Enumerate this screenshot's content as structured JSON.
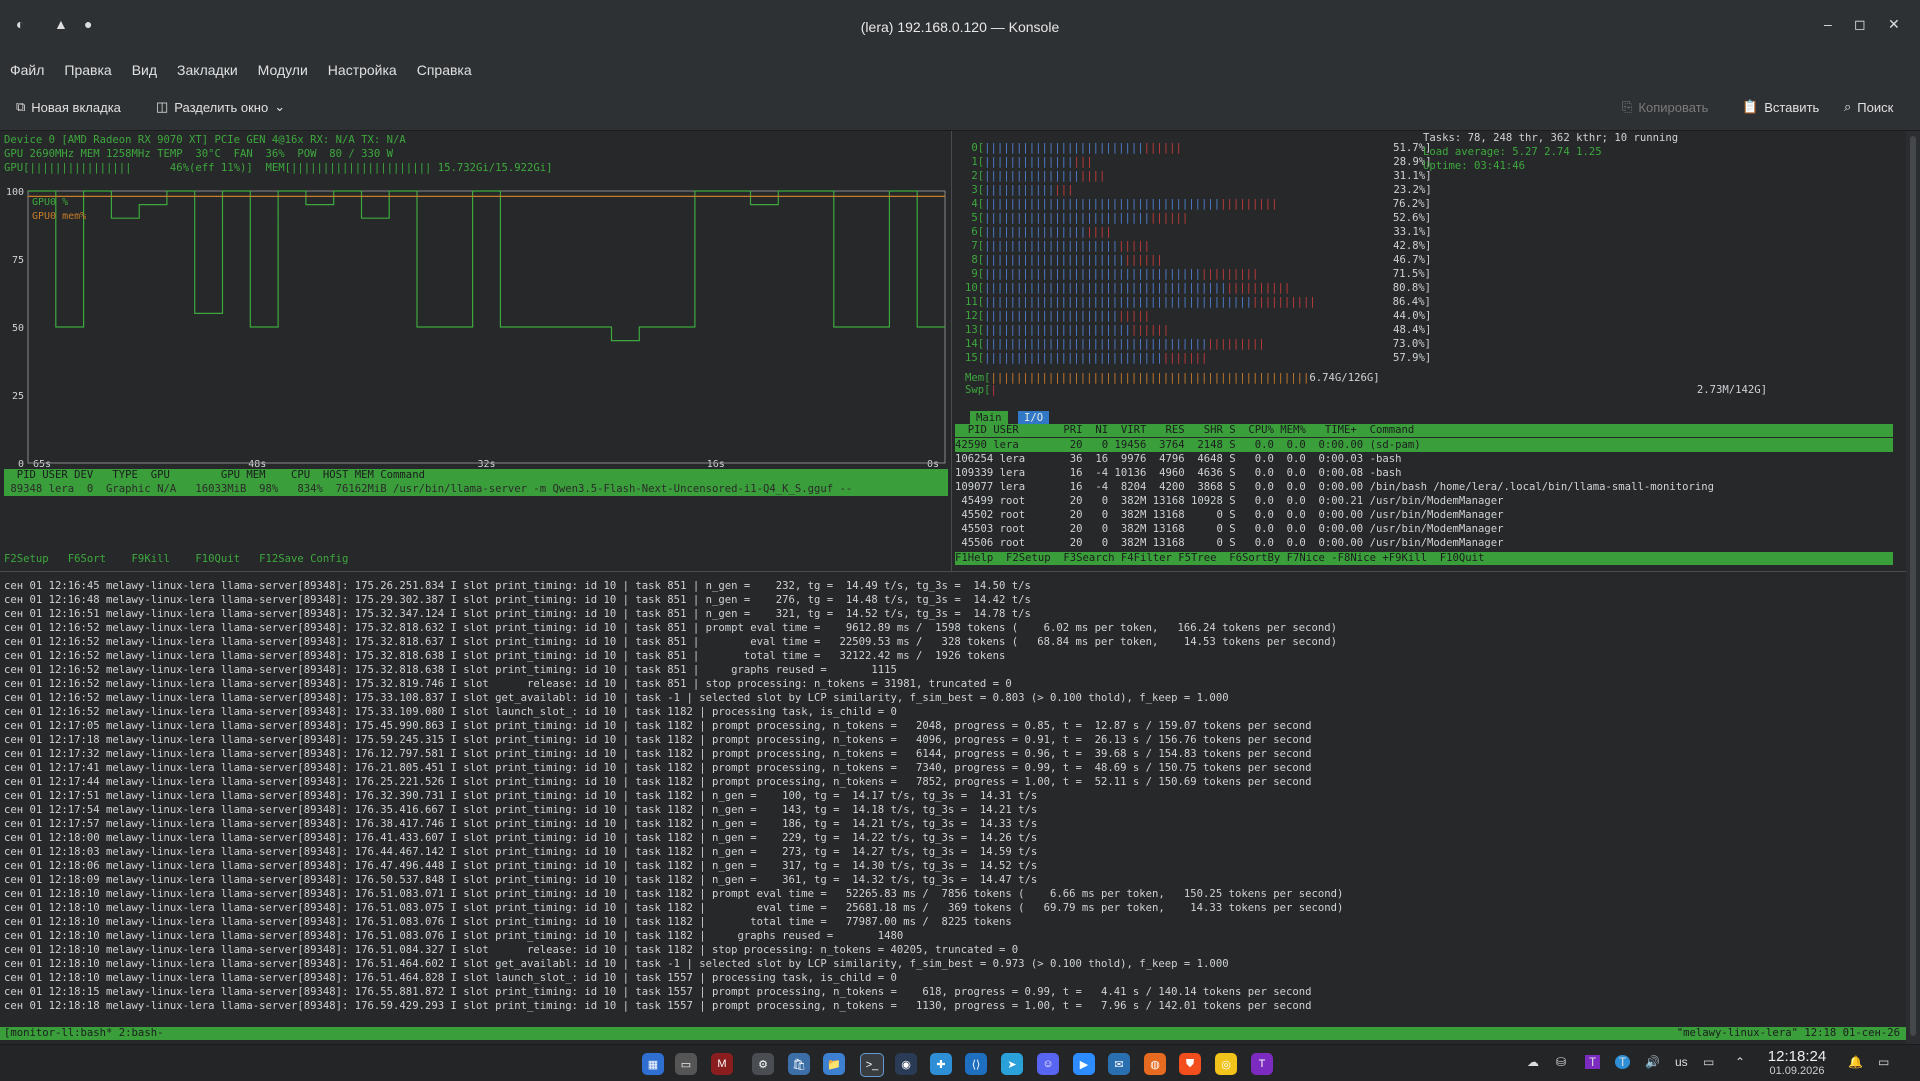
{
  "window": {
    "title": "(lera) 192.168.0.120 — Konsole"
  },
  "menu": [
    "Файл",
    "Правка",
    "Вид",
    "Закладки",
    "Модули",
    "Настройка",
    "Справка"
  ],
  "toolbar": {
    "new_tab": "Новая вкладка",
    "split": "Разделить окно",
    "copy": "Копировать",
    "paste": "Вставить",
    "search": "Поиск"
  },
  "nvtop": {
    "device": "Device 0 [AMD Radeon RX 9070 XT] PCIe GEN 4@16x RX: N/A TX: N/A",
    "gpu_line": "GPU 2690MHz MEM 1258MHz TEMP  30°C  FAN  36%  POW  80 / 330 W",
    "gpu_bar": "GPU[||||||||||||||||      46%(eff 11%)]  MEM[|||||||||||||||||||||| 15.732Gi/15.922Gi]",
    "y_ticks": [
      "100",
      "75",
      "50",
      "25",
      "0"
    ],
    "x_ticks": [
      "65s",
      "48s",
      "32s",
      "16s",
      "0s"
    ],
    "legend": [
      "GPU0 %",
      "GPU0 mem%"
    ],
    "proc_header": "  PID USER DEV   TYPE  GPU        GPU MEM    CPU  HOST MEM Command",
    "proc_row": " 89348 lera  0  Graphic N/A   16033MiB  98%   834%  76162MiB /usr/bin/llama-server -m Qwen3.5-Flash-Next-Uncensored-i1-Q4_K_S.gguf --",
    "fkeys": "F2Setup   F6Sort    F9Kill    F10Quit   F12Save Config"
  },
  "chart_data": {
    "type": "line",
    "title": "",
    "xlabel": "",
    "ylabel": "",
    "ylim": [
      0,
      100
    ],
    "x_ticks": [
      "65s",
      "48s",
      "32s",
      "16s",
      "0s"
    ],
    "series": [
      {
        "name": "GPU0 %",
        "color": "#3ea83e",
        "values": [
          100,
          50,
          100,
          90,
          95,
          100,
          55,
          100,
          50,
          100,
          95,
          100,
          90,
          100,
          50,
          50,
          100,
          50,
          50,
          50,
          50,
          45,
          50,
          50,
          100,
          100,
          95,
          100,
          100,
          50,
          50,
          100,
          50
        ]
      },
      {
        "name": "GPU0 mem%",
        "color": "#c87c2a",
        "values": [
          98,
          98,
          98,
          98,
          98,
          98,
          98,
          98,
          98,
          98,
          98,
          98,
          98,
          98,
          98,
          98,
          98,
          98,
          98,
          98,
          98,
          98,
          98,
          98,
          98,
          98,
          98,
          98,
          98,
          98,
          98,
          98,
          98
        ]
      }
    ]
  },
  "htop": {
    "cpus": [
      {
        "n": "0",
        "pct": "51.7%"
      },
      {
        "n": "1",
        "pct": "28.9%"
      },
      {
        "n": "2",
        "pct": "31.1%"
      },
      {
        "n": "3",
        "pct": "23.2%"
      },
      {
        "n": "4",
        "pct": "76.2%"
      },
      {
        "n": "5",
        "pct": "52.6%"
      },
      {
        "n": "6",
        "pct": "33.1%"
      },
      {
        "n": "7",
        "pct": "42.8%"
      },
      {
        "n": "8",
        "pct": "46.7%"
      },
      {
        "n": "9",
        "pct": "71.5%"
      },
      {
        "n": "10",
        "pct": "80.8%"
      },
      {
        "n": "11",
        "pct": "86.4%"
      },
      {
        "n": "12",
        "pct": "44.0%"
      },
      {
        "n": "13",
        "pct": "48.4%"
      },
      {
        "n": "14",
        "pct": "73.0%"
      },
      {
        "n": "15",
        "pct": "57.9%"
      }
    ],
    "mem": "6.74G/126G",
    "swp": "2.73M/142G",
    "tasks": "Tasks: 78, 248 thr, 362 kthr; 10 running",
    "load": "Load average: 5.27 2.74 1.25",
    "uptime": "Uptime: 03:41:46",
    "tabs": [
      "Main",
      "I/O"
    ],
    "header": "  PID USER       PRI  NI  VIRT   RES   SHR S  CPU% MEM%   TIME+  Command",
    "rows": [
      "42590 lera        20   0 19456  3764  2148 S   0.0  0.0  0:00.00 (sd-pam)",
      "106254 lera       36  16  9976  4796  4648 S   0.0  0.0  0:00.03 -bash",
      "109339 lera       16  -4 10136  4960  4636 S   0.0  0.0  0:00.08 -bash",
      "109077 lera       16  -4  8204  4200  3868 S   0.0  0.0  0:00.00 /bin/bash /home/lera/.local/bin/llama-small-monitoring",
      " 45499 root       20   0  382M 13168 10928 S   0.0  0.0  0:00.21 /usr/bin/ModemManager",
      " 45502 root       20   0  382M 13168     0 S   0.0  0.0  0:00.00 /usr/bin/ModemManager",
      " 45503 root       20   0  382M 13168     0 S   0.0  0.0  0:00.00 /usr/bin/ModemManager",
      " 45506 root       20   0  382M 13168     0 S   0.0  0.0  0:00.00 /usr/bin/ModemManager"
    ],
    "fkeys": "F1Help  F2Setup  F3Search F4Filter F5Tree  F6SortBy F7Nice -F8Nice +F9Kill  F10Quit"
  },
  "log": [
    "сен 01 12:16:45 melawy-linux-lera llama-server[89348]: 175.26.251.834 I slot print_timing: id 10 | task 851 | n_gen =    232, tg =  14.49 t/s, tg_3s =  14.50 t/s",
    "сен 01 12:16:48 melawy-linux-lera llama-server[89348]: 175.29.302.387 I slot print_timing: id 10 | task 851 | n_gen =    276, tg =  14.48 t/s, tg_3s =  14.42 t/s",
    "сен 01 12:16:51 melawy-linux-lera llama-server[89348]: 175.32.347.124 I slot print_timing: id 10 | task 851 | n_gen =    321, tg =  14.52 t/s, tg_3s =  14.78 t/s",
    "сен 01 12:16:52 melawy-linux-lera llama-server[89348]: 175.32.818.632 I slot print_timing: id 10 | task 851 | prompt eval time =    9612.89 ms /  1598 tokens (    6.02 ms per token,   166.24 tokens per second)",
    "сен 01 12:16:52 melawy-linux-lera llama-server[89348]: 175.32.818.637 I slot print_timing: id 10 | task 851 |        eval time =   22509.53 ms /   328 tokens (   68.84 ms per token,    14.53 tokens per second)",
    "сен 01 12:16:52 melawy-linux-lera llama-server[89348]: 175.32.818.638 I slot print_timing: id 10 | task 851 |       total time =   32122.42 ms /  1926 tokens",
    "сен 01 12:16:52 melawy-linux-lera llama-server[89348]: 175.32.818.638 I slot print_timing: id 10 | task 851 |     graphs reused =       1115",
    "сен 01 12:16:52 melawy-linux-lera llama-server[89348]: 175.32.819.746 I slot      release: id 10 | task 851 | stop processing: n_tokens = 31981, truncated = 0",
    "сен 01 12:16:52 melawy-linux-lera llama-server[89348]: 175.33.108.837 I slot get_availabl: id 10 | task -1 | selected slot by LCP similarity, f_sim_best = 0.803 (> 0.100 thold), f_keep = 1.000",
    "сен 01 12:16:52 melawy-linux-lera llama-server[89348]: 175.33.109.080 I slot launch_slot_: id 10 | task 1182 | processing task, is_child = 0",
    "сен 01 12:17:05 melawy-linux-lera llama-server[89348]: 175.45.990.863 I slot print_timing: id 10 | task 1182 | prompt processing, n_tokens =   2048, progress = 0.85, t =  12.87 s / 159.07 tokens per second",
    "сен 01 12:17:18 melawy-linux-lera llama-server[89348]: 175.59.245.315 I slot print_timing: id 10 | task 1182 | prompt processing, n_tokens =   4096, progress = 0.91, t =  26.13 s / 156.76 tokens per second",
    "сен 01 12:17:32 melawy-linux-lera llama-server[89348]: 176.12.797.581 I slot print_timing: id 10 | task 1182 | prompt processing, n_tokens =   6144, progress = 0.96, t =  39.68 s / 154.83 tokens per second",
    "сен 01 12:17:41 melawy-linux-lera llama-server[89348]: 176.21.805.451 I slot print_timing: id 10 | task 1182 | prompt processing, n_tokens =   7340, progress = 0.99, t =  48.69 s / 150.75 tokens per second",
    "сен 01 12:17:44 melawy-linux-lera llama-server[89348]: 176.25.221.526 I slot print_timing: id 10 | task 1182 | prompt processing, n_tokens =   7852, progress = 1.00, t =  52.11 s / 150.69 tokens per second",
    "сен 01 12:17:51 melawy-linux-lera llama-server[89348]: 176.32.390.731 I slot print_timing: id 10 | task 1182 | n_gen =    100, tg =  14.17 t/s, tg_3s =  14.31 t/s",
    "сен 01 12:17:54 melawy-linux-lera llama-server[89348]: 176.35.416.667 I slot print_timing: id 10 | task 1182 | n_gen =    143, tg =  14.18 t/s, tg_3s =  14.21 t/s",
    "сен 01 12:17:57 melawy-linux-lera llama-server[89348]: 176.38.417.746 I slot print_timing: id 10 | task 1182 | n_gen =    186, tg =  14.21 t/s, tg_3s =  14.33 t/s",
    "сен 01 12:18:00 melawy-linux-lera llama-server[89348]: 176.41.433.607 I slot print_timing: id 10 | task 1182 | n_gen =    229, tg =  14.22 t/s, tg_3s =  14.26 t/s",
    "сен 01 12:18:03 melawy-linux-lera llama-server[89348]: 176.44.467.142 I slot print_timing: id 10 | task 1182 | n_gen =    273, tg =  14.27 t/s, tg_3s =  14.59 t/s",
    "сен 01 12:18:06 melawy-linux-lera llama-server[89348]: 176.47.496.448 I slot print_timing: id 10 | task 1182 | n_gen =    317, tg =  14.30 t/s, tg_3s =  14.52 t/s",
    "сен 01 12:18:09 melawy-linux-lera llama-server[89348]: 176.50.537.848 I slot print_timing: id 10 | task 1182 | n_gen =    361, tg =  14.32 t/s, tg_3s =  14.47 t/s",
    "сен 01 12:18:10 melawy-linux-lera llama-server[89348]: 176.51.083.071 I slot print_timing: id 10 | task 1182 | prompt eval time =   52265.83 ms /  7856 tokens (    6.66 ms per token,   150.25 tokens per second)",
    "сен 01 12:18:10 melawy-linux-lera llama-server[89348]: 176.51.083.075 I slot print_timing: id 10 | task 1182 |        eval time =   25681.18 ms /   369 tokens (   69.79 ms per token,    14.33 tokens per second)",
    "сен 01 12:18:10 melawy-linux-lera llama-server[89348]: 176.51.083.076 I slot print_timing: id 10 | task 1182 |       total time =   77987.00 ms /  8225 tokens",
    "сен 01 12:18:10 melawy-linux-lera llama-server[89348]: 176.51.083.076 I slot print_timing: id 10 | task 1182 |     graphs reused =       1480",
    "сен 01 12:18:10 melawy-linux-lera llama-server[89348]: 176.51.084.327 I slot      release: id 10 | task 1182 | stop processing: n_tokens = 40205, truncated = 0",
    "сен 01 12:18:10 melawy-linux-lera llama-server[89348]: 176.51.464.602 I slot get_availabl: id 10 | task -1 | selected slot by LCP similarity, f_sim_best = 0.973 (> 0.100 thold), f_keep = 1.000",
    "сен 01 12:18:10 melawy-linux-lera llama-server[89348]: 176.51.464.828 I slot launch_slot_: id 10 | task 1557 | processing task, is_child = 0",
    "сен 01 12:18:15 melawy-linux-lera llama-server[89348]: 176.55.881.872 I slot print_timing: id 10 | task 1557 | prompt processing, n_tokens =    618, progress = 0.99, t =   4.41 s / 140.14 tokens per second",
    "сен 01 12:18:18 melawy-linux-lera llama-server[89348]: 176.59.429.293 I slot print_timing: id 10 | task 1557 | prompt processing, n_tokens =   1130, progress = 1.00, t =   7.96 s / 142.01 tokens per second"
  ],
  "tmux": {
    "left": "[monitor-ll:bash* 2:bash-",
    "right": "\"melawy-linux-lera\" 12:18 01-сен-26"
  },
  "clock": {
    "time": "12:18:24",
    "date": "01.09.2026"
  },
  "tray": {
    "lang": "us"
  }
}
